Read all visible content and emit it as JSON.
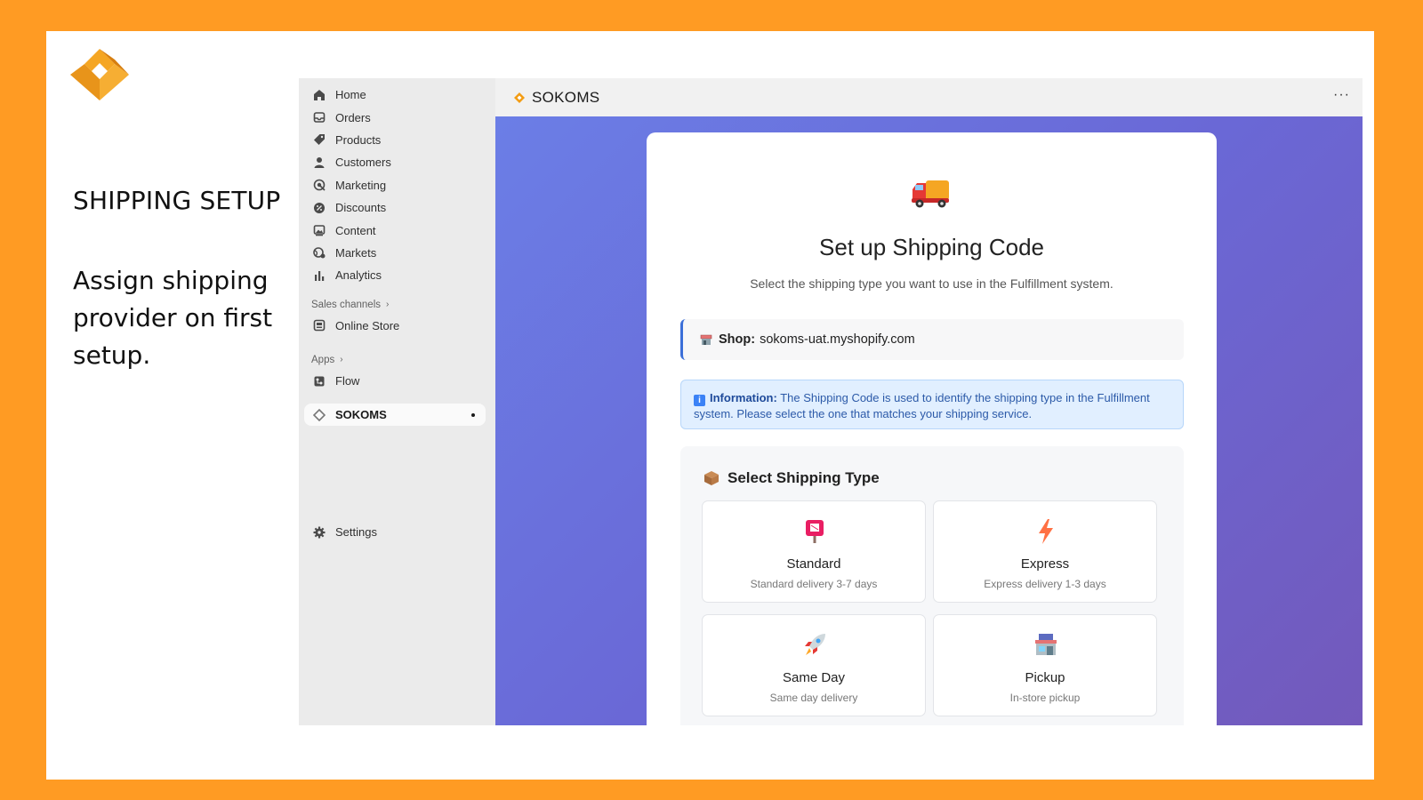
{
  "slide": {
    "title": "SHIPPING SETUP",
    "description": "Assign shipping provider on first setup."
  },
  "sidebar": {
    "items": [
      {
        "label": "Home",
        "icon": "home-icon"
      },
      {
        "label": "Orders",
        "icon": "inbox-icon"
      },
      {
        "label": "Products",
        "icon": "tag-icon"
      },
      {
        "label": "Customers",
        "icon": "person-icon"
      },
      {
        "label": "Marketing",
        "icon": "target-icon"
      },
      {
        "label": "Discounts",
        "icon": "discount-icon"
      },
      {
        "label": "Content",
        "icon": "image-icon"
      },
      {
        "label": "Markets",
        "icon": "globe-icon"
      },
      {
        "label": "Analytics",
        "icon": "bar-chart-icon"
      }
    ],
    "sales_channels_label": "Sales channels",
    "online_store_label": "Online Store",
    "apps_label": "Apps",
    "flow_label": "Flow",
    "active_app_label": "SOKOMS",
    "settings_label": "Settings"
  },
  "topbar": {
    "app_name": "SOKOMS",
    "more_label": "···"
  },
  "card": {
    "title": "Set up Shipping Code",
    "subtitle": "Select the shipping type you want to use in the Fulfillment system.",
    "shop_label": "Shop:",
    "shop_value": "sokoms-uat.myshopify.com",
    "info_label": "Information:",
    "info_text": "The Shipping Code is used to identify the shipping type in the Fulfillment system. Please select the one that matches your shipping service.",
    "select_title": "Select Shipping Type",
    "options": [
      {
        "name": "Standard",
        "desc": "Standard delivery 3-7 days",
        "icon": "mailbox-icon"
      },
      {
        "name": "Express",
        "desc": "Express delivery 1-3 days",
        "icon": "lightning-icon"
      },
      {
        "name": "Same Day",
        "desc": "Same day delivery",
        "icon": "rocket-icon"
      },
      {
        "name": "Pickup",
        "desc": "In-store pickup",
        "icon": "store-icon"
      }
    ]
  },
  "colors": {
    "frame": "#FF9B23",
    "brand_orange": "#F39C12",
    "gradient_start": "#6b7ee6",
    "gradient_end": "#7359bb",
    "accent_blue": "#3b6fd8"
  }
}
